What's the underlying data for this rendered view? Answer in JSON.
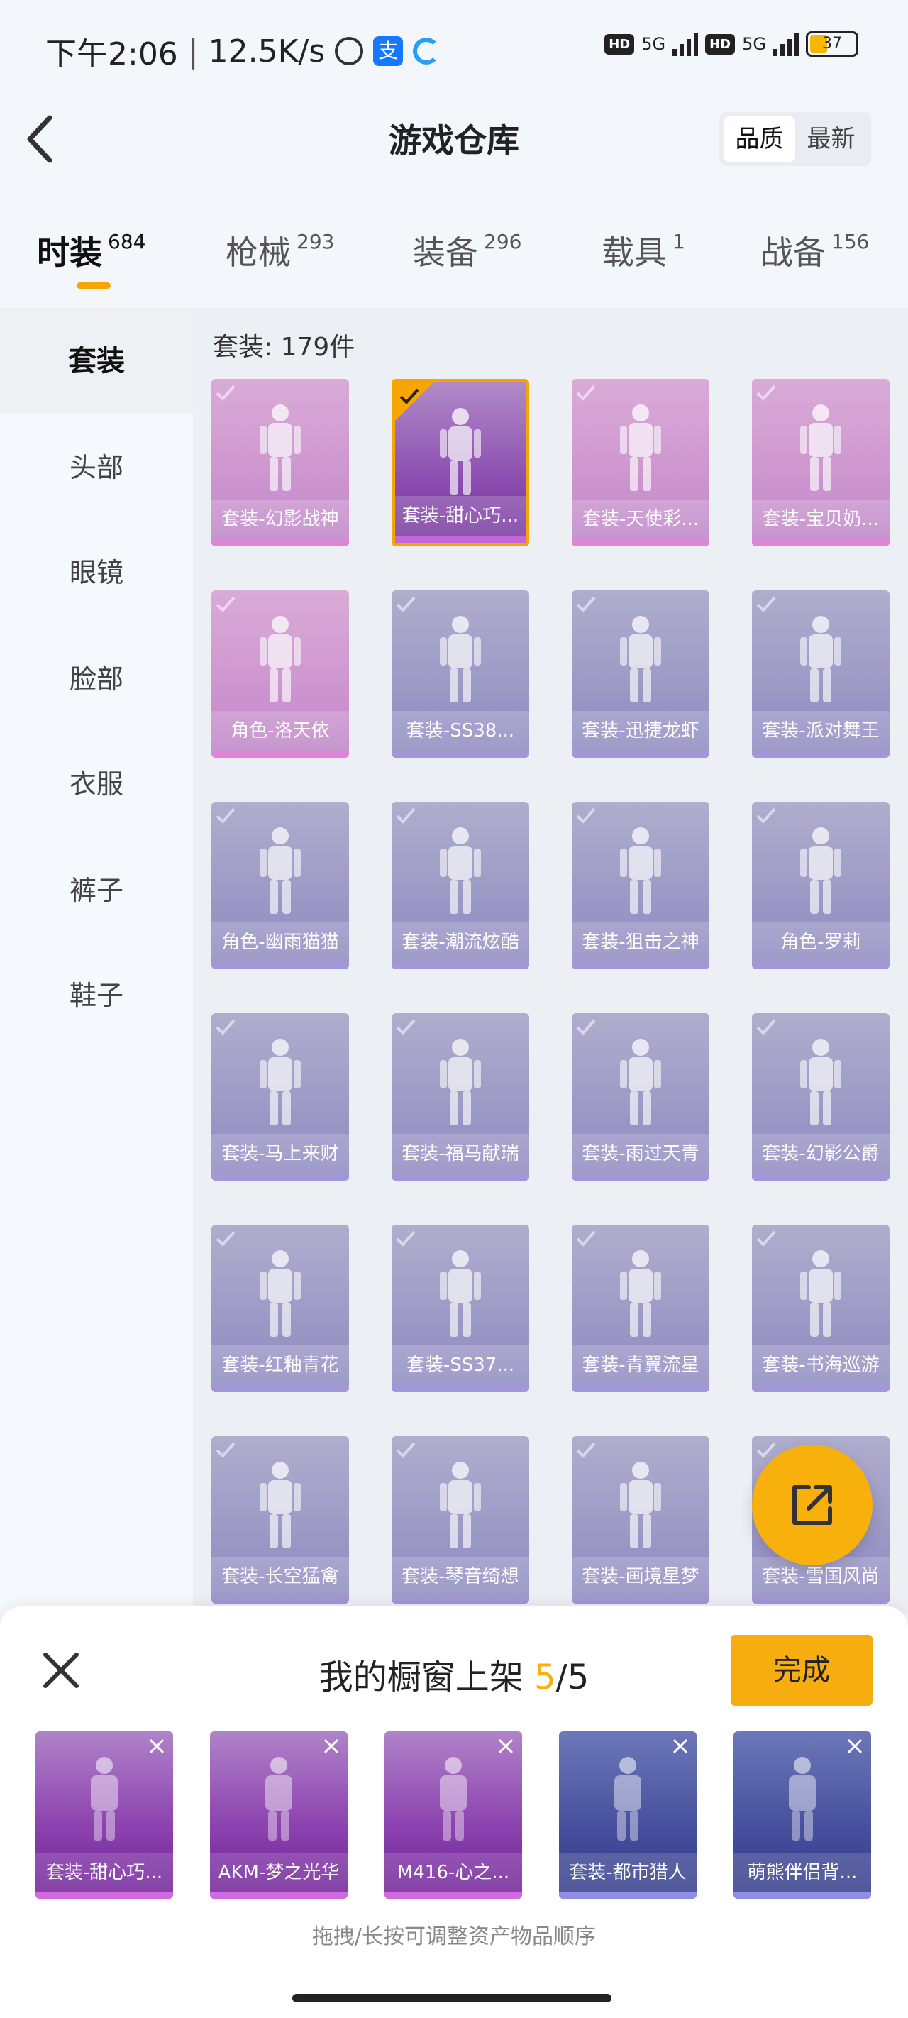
{
  "status_bar": {
    "time": "下午2:06",
    "net_speed": "12.5K/s",
    "alipay_glyph": "支",
    "hd1": "HD",
    "net1": "5G",
    "hd2": "HD",
    "net2": "5G",
    "battery": "37"
  },
  "header": {
    "title": "游戏仓库",
    "sort_options": [
      "品质",
      "最新"
    ],
    "active_sort": "品质"
  },
  "categories": [
    {
      "label": "时装",
      "count": "684"
    },
    {
      "label": "枪械",
      "count": "293"
    },
    {
      "label": "装备",
      "count": "296"
    },
    {
      "label": "载具",
      "count": "1"
    },
    {
      "label": "战备",
      "count": "156"
    }
  ],
  "sidebar": {
    "items": [
      "套装",
      "头部",
      "眼镜",
      "脸部",
      "衣服",
      "裤子",
      "鞋子"
    ],
    "active": "套装"
  },
  "grid": {
    "count_label": "套装: 179件",
    "items": [
      {
        "label": "套装-幻影战神",
        "tier": "pink",
        "selected": false
      },
      {
        "label": "套装-甜心巧...",
        "tier": "gold",
        "selected": true
      },
      {
        "label": "套装-天使彩...",
        "tier": "pink",
        "selected": false
      },
      {
        "label": "套装-宝贝奶...",
        "tier": "pink",
        "selected": false
      },
      {
        "label": "角色-洛天依",
        "tier": "pink",
        "selected": false
      },
      {
        "label": "套装-SS38...",
        "tier": "purple",
        "selected": false
      },
      {
        "label": "套装-迅捷龙虾",
        "tier": "purple",
        "selected": false
      },
      {
        "label": "套装-派对舞王",
        "tier": "purple",
        "selected": false
      },
      {
        "label": "角色-幽雨猫猫",
        "tier": "purple",
        "selected": false
      },
      {
        "label": "套装-潮流炫酷",
        "tier": "purple",
        "selected": false
      },
      {
        "label": "套装-狙击之神",
        "tier": "purple",
        "selected": false
      },
      {
        "label": "角色-罗莉",
        "tier": "purple",
        "selected": false
      },
      {
        "label": "套装-马上来财",
        "tier": "purple",
        "selected": false
      },
      {
        "label": "套装-福马献瑞",
        "tier": "purple",
        "selected": false
      },
      {
        "label": "套装-雨过天青",
        "tier": "purple",
        "selected": false
      },
      {
        "label": "套装-幻影公爵",
        "tier": "purple",
        "selected": false
      },
      {
        "label": "套装-红釉青花",
        "tier": "purple",
        "selected": false
      },
      {
        "label": "套装-SS37...",
        "tier": "purple",
        "selected": false
      },
      {
        "label": "套装-青翼流星",
        "tier": "purple",
        "selected": false
      },
      {
        "label": "套装-书海巡游",
        "tier": "purple",
        "selected": false
      },
      {
        "label": "套装-长空猛禽",
        "tier": "purple",
        "selected": false
      },
      {
        "label": "套装-琴音绮想",
        "tier": "purple",
        "selected": false
      },
      {
        "label": "套装-画境星梦",
        "tier": "purple",
        "selected": false
      },
      {
        "label": "套装-雪国风尚",
        "tier": "purple",
        "selected": false
      }
    ]
  },
  "showcase": {
    "title": "我的橱窗上架",
    "current": "5",
    "separator": "/",
    "max": "5",
    "done_label": "完成",
    "slots": [
      {
        "label": "套装-甜心巧...",
        "tier": "pink"
      },
      {
        "label": "AKM-梦之光华",
        "tier": "pink"
      },
      {
        "label": "M416-心之...",
        "tier": "pink"
      },
      {
        "label": "套装-都市猎人",
        "tier": "blue"
      },
      {
        "label": "萌熊伴侣背...",
        "tier": "blue"
      }
    ],
    "hint": "拖拽/长按可调整资产物品顺序"
  },
  "colors": {
    "accent": "#f7a500",
    "pink_tier": "#c98dcc",
    "purple_tier": "#8f8bc0"
  }
}
